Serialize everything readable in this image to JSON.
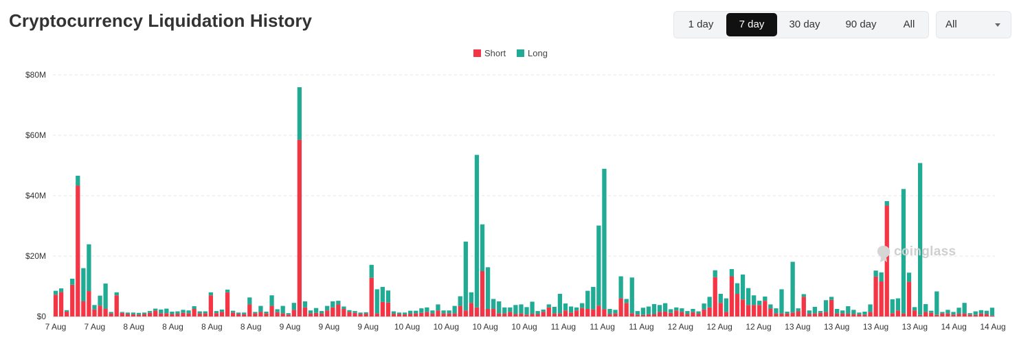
{
  "header": {
    "title": "Cryptocurrency Liquidation History"
  },
  "range_tabs": [
    {
      "label": "1 day",
      "active": false
    },
    {
      "label": "7 day",
      "active": true
    },
    {
      "label": "30 day",
      "active": false
    },
    {
      "label": "90 day",
      "active": false
    },
    {
      "label": "All",
      "active": false
    }
  ],
  "exchange_select": {
    "value": "All"
  },
  "watermark": {
    "text": "coinglass"
  },
  "colors": {
    "short": "#f23645",
    "long": "#22ab94",
    "grid": "#e6e6e6",
    "axis_text": "#333333"
  },
  "chart_data": {
    "type": "bar",
    "stacked": true,
    "ylim": [
      0,
      80
    ],
    "y_unit": "$M",
    "y_ticks": [
      "$0",
      "$20M",
      "$40M",
      "$60M",
      "$80M"
    ],
    "x_tick_labels": [
      "7 Aug",
      "7 Aug",
      "8 Aug",
      "8 Aug",
      "8 Aug",
      "8 Aug",
      "9 Aug",
      "9 Aug",
      "9 Aug",
      "10 Aug",
      "10 Aug",
      "10 Aug",
      "10 Aug",
      "11 Aug",
      "11 Aug",
      "11 Aug",
      "12 Aug",
      "12 Aug",
      "12 Aug",
      "13 Aug",
      "13 Aug",
      "13 Aug",
      "13 Aug",
      "14 Aug",
      "14 Aug"
    ],
    "legend": "top-center",
    "grid": true,
    "series": [
      {
        "name": "Short",
        "color": "#f23645",
        "values": [
          7.2,
          8.1,
          1.6,
          10.5,
          43.3,
          5.0,
          8.4,
          2.3,
          3.6,
          2.6,
          1.0,
          7.0,
          1.2,
          0.8,
          0.7,
          0.6,
          0.8,
          1.2,
          2.0,
          1.0,
          1.1,
          0.8,
          0.9,
          1.2,
          1.0,
          2.5,
          1.0,
          1.0,
          7.0,
          1.1,
          1.5,
          8.0,
          1.3,
          0.8,
          0.7,
          4.0,
          1.0,
          1.5,
          1.0,
          3.5,
          1.4,
          1.0,
          0.6,
          2.2,
          58.5,
          3.0,
          1.0,
          1.2,
          1.0,
          2.0,
          3.0,
          4.0,
          2.5,
          1.5,
          1.2,
          0.8,
          0.9,
          12.8,
          1.0,
          4.8,
          4.6,
          0.9,
          0.8,
          0.7,
          0.9,
          1.0,
          1.2,
          1.5,
          1.0,
          2.0,
          1.0,
          1.0,
          1.0,
          3.5,
          2.0,
          4.5,
          3.0,
          15.0,
          2.5,
          2.5,
          1.0,
          1.0,
          1.5,
          0.8,
          1.0,
          0.6,
          0.9,
          0.8,
          1.5,
          3.0,
          1.0,
          1.0,
          2.0,
          1.3,
          2.0,
          2.8,
          2.5,
          2.3,
          3.6,
          2.4,
          0.8,
          1.0,
          6.0,
          4.5,
          1.1,
          0.6,
          0.5,
          0.7,
          0.8,
          1.5,
          1.6,
          1.2,
          2.0,
          1.5,
          0.8,
          1.4,
          0.9,
          2.3,
          3.0,
          13.0,
          4.5,
          1.5,
          13.3,
          7.5,
          5.6,
          3.8,
          3.8,
          3.8,
          5.2,
          2.6,
          1.0,
          1.0,
          1.0,
          1.3,
          1.8,
          6.5,
          0.9,
          1.0,
          1.2,
          1.5,
          5.5,
          1.0,
          1.0,
          0.9,
          0.8,
          0.7,
          0.6,
          1.5,
          13.2,
          11.6,
          36.7,
          1.1,
          2.0,
          1.0,
          11.5,
          2.0,
          0.5,
          1.5,
          1.2,
          0.5,
          1.0,
          1.0,
          0.6,
          0.9,
          1.0,
          0.6,
          0.5,
          1.0,
          0.8,
          0.3
        ]
      },
      {
        "name": "Long",
        "color": "#22ab94",
        "values": [
          1.3,
          1.2,
          0.5,
          2.0,
          3.3,
          11.0,
          15.5,
          1.5,
          3.3,
          8.3,
          0.5,
          1.0,
          0.3,
          0.5,
          0.6,
          0.6,
          0.5,
          0.6,
          0.6,
          1.3,
          1.5,
          0.8,
          0.8,
          1.0,
          1.0,
          0.9,
          0.7,
          0.7,
          1.0,
          0.7,
          0.8,
          0.9,
          0.6,
          0.5,
          0.6,
          2.3,
          0.5,
          2.0,
          0.6,
          3.5,
          1.0,
          2.5,
          0.5,
          2.3,
          17.4,
          2.0,
          1.0,
          1.6,
          0.8,
          1.5,
          2.0,
          1.2,
          0.8,
          0.6,
          0.6,
          0.5,
          0.5,
          4.3,
          8.0,
          5.0,
          4.0,
          0.8,
          0.5,
          0.6,
          1.0,
          0.9,
          1.5,
          1.5,
          1.0,
          2.0,
          1.0,
          1.0,
          2.5,
          3.2,
          22.8,
          3.5,
          50.5,
          15.5,
          13.8,
          3.3,
          4.0,
          2.0,
          1.5,
          3.0,
          3.0,
          2.5,
          4.0,
          1.0,
          0.8,
          1.0,
          2.2,
          6.5,
          2.3,
          2.0,
          1.0,
          1.6,
          6.0,
          7.5,
          26.5,
          46.5,
          1.7,
          1.2,
          7.3,
          1.3,
          11.8,
          1.2,
          2.4,
          2.6,
          3.3,
          2.3,
          2.8,
          1.2,
          1.0,
          1.2,
          1.0,
          1.1,
          0.8,
          2.0,
          3.5,
          2.3,
          3.0,
          4.5,
          2.4,
          3.5,
          8.3,
          5.6,
          3.2,
          1.4,
          1.4,
          1.4,
          1.7,
          8.0,
          0.6,
          16.8,
          0.9,
          0.9,
          1.1,
          2.2,
          0.6,
          3.9,
          1.0,
          1.5,
          1.0,
          2.5,
          1.4,
          0.6,
          1.0,
          2.5,
          2.0,
          3.0,
          1.5,
          4.6,
          4.0,
          41.2,
          3.0,
          1.1,
          50.3,
          2.6,
          0.7,
          7.8,
          0.5,
          1.2,
          0.9,
          2.0,
          3.5,
          0.5,
          1.2,
          1.1,
          1.1,
          2.6,
          1.5,
          1.5,
          3.2,
          7.8,
          2.2,
          0.5
        ]
      }
    ]
  }
}
